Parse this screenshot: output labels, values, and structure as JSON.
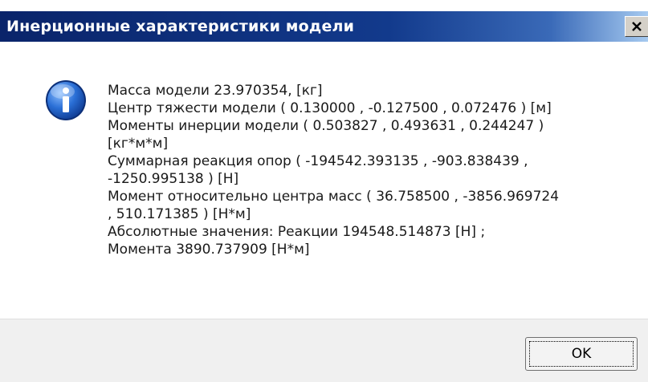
{
  "window": {
    "title": "Инерционные характеристики модели",
    "close_icon": "close-icon"
  },
  "message": {
    "icon": "info-icon",
    "lines": [
      "Масса модели  23.970354, [кг]",
      "Центр тяжести модели  ( 0.130000 , -0.127500 , 0.072476 ) [м]",
      "Моменты инерции модели ( 0.503827 , 0.493631 , 0.244247 )",
      "[кг*м*м]",
      "Суммарная реакция опор ( -194542.393135 , -903.838439 ,",
      "-1250.995138 ) [Н]",
      "Момент относительно центра масс ( 36.758500 , -3856.969724",
      ", 510.171385 ) [Н*м]",
      "Абсолютные значения:   Реакции 194548.514873 [Н]  ;",
      "Момента 3890.737909 [Н*м]"
    ]
  },
  "buttons": {
    "ok_label": "OK"
  }
}
